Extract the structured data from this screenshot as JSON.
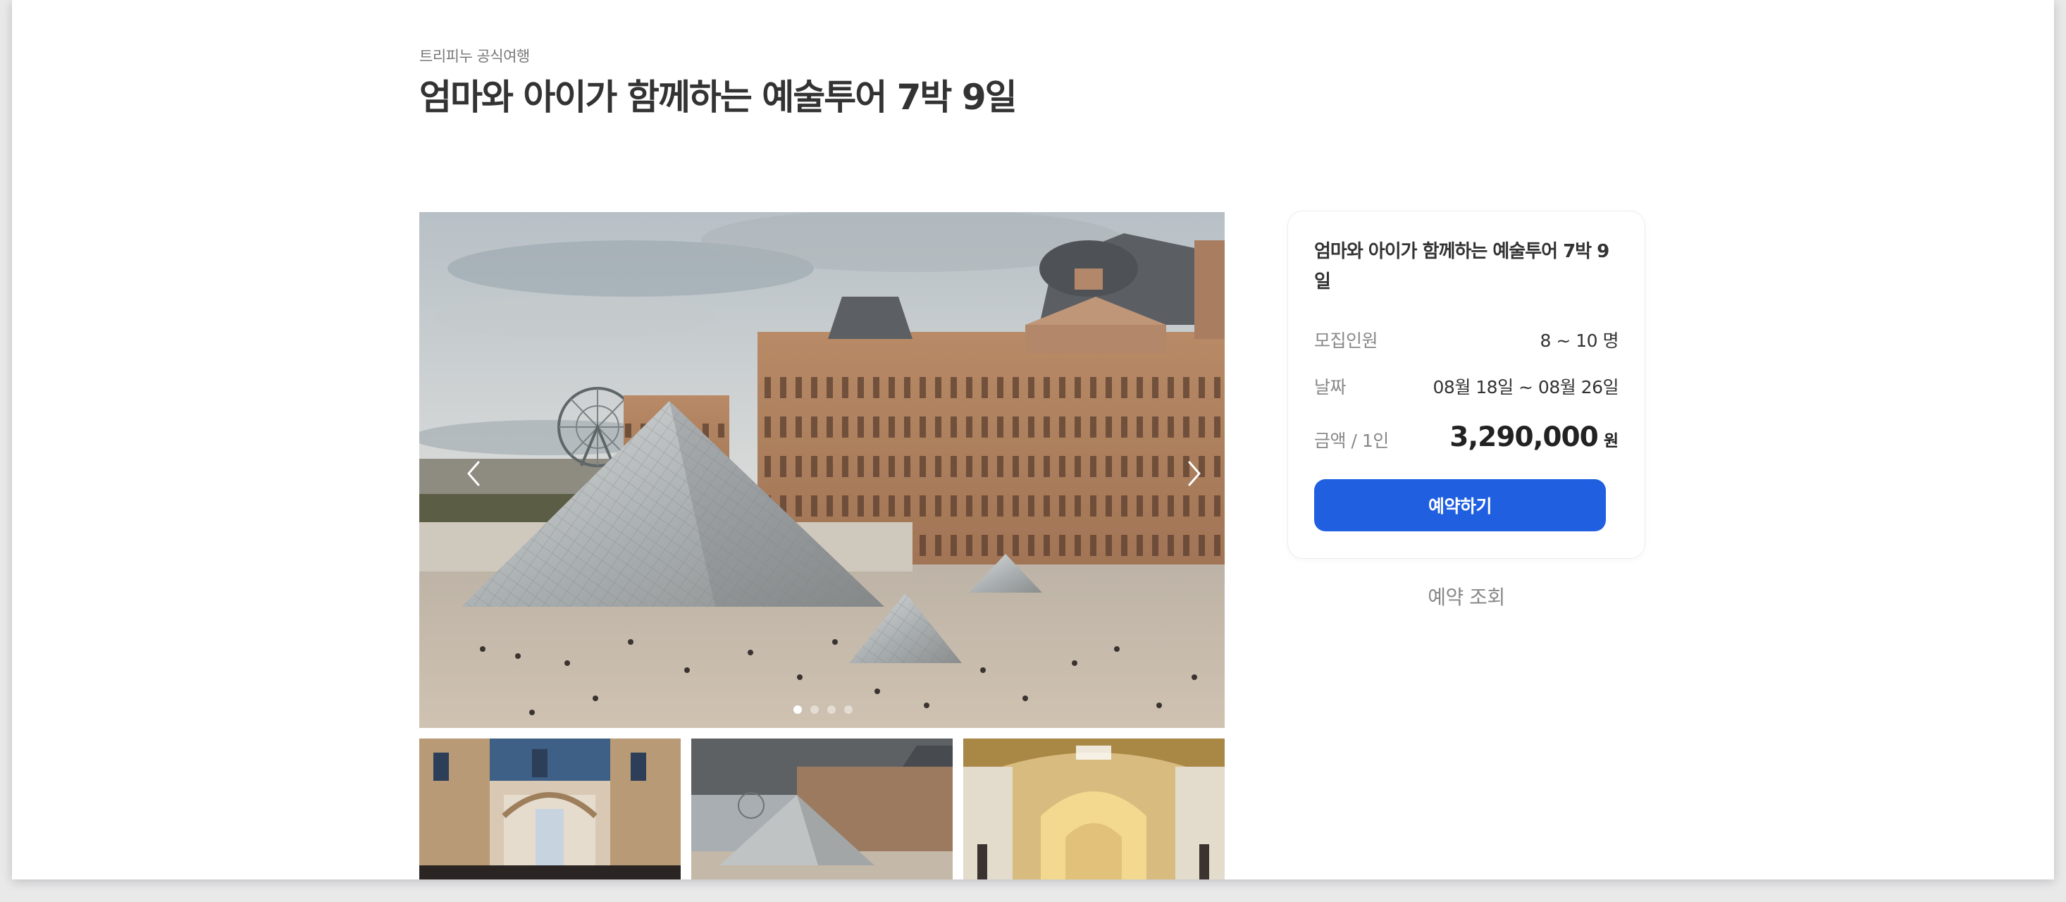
{
  "header": {
    "subtitle": "트리피누 공식여행",
    "title": "엄마와 아이가 함께하는 예술투어 7박 9일"
  },
  "gallery": {
    "prev_icon": "chevron-left-icon",
    "next_icon": "chevron-right-icon",
    "slide_count": 4,
    "active_slide": 1,
    "thumbnails": [
      "uffizi-gallery-thumbnail",
      "louvre-pyramid-thumbnail",
      "museum-gallery-hall-thumbnail"
    ]
  },
  "booking": {
    "title": "엄마와 아이가 함께하는 예술투어 7박 9일",
    "capacity_label": "모집인원",
    "capacity_value": "8 ~ 10 명",
    "date_label": "날짜",
    "date_value": "08월 18일 ~ 08월 26일",
    "price_label": "금액 / 1인",
    "price_value": "3,290,000",
    "price_unit": "원",
    "book_button": "예약하기",
    "lookup_link": "예약 조회"
  },
  "colors": {
    "accent": "#1f5fe0",
    "title_text": "#333333",
    "muted_text": "#888888"
  }
}
